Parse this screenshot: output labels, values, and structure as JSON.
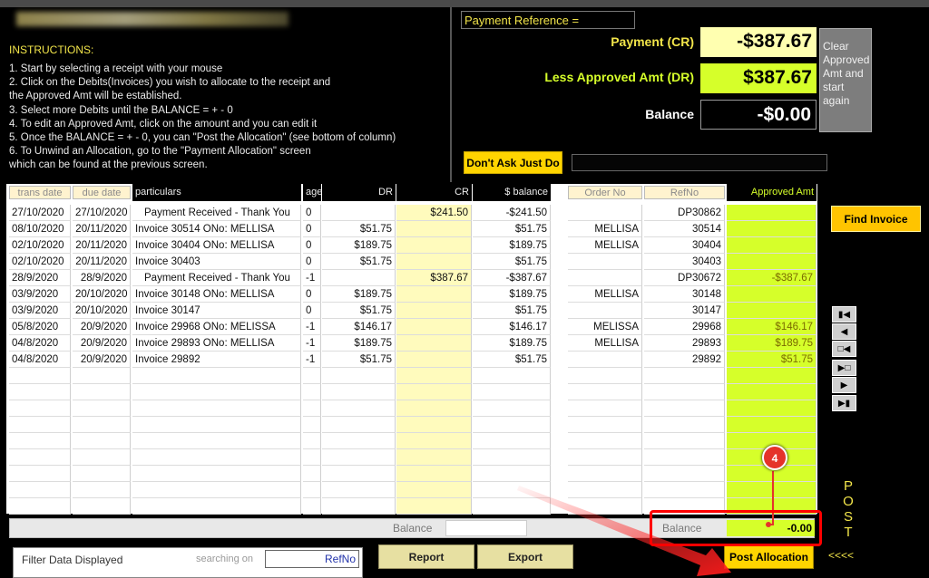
{
  "instructions": {
    "title": "INSTRUCTIONS:",
    "lines": [
      "1. Start by selecting a receipt with your mouse",
      "2. Click on the Debits(Invoices) you wish to allocate to the receipt and",
      "    the Approved Amt will be established.",
      "3. Select more Debits until the BALANCE = + - 0",
      "4. To edit an Approved Amt, click on the amount and you can edit it",
      "5. Once the BALANCE = + - 0, you can \"Post the Allocation\" (see bottom of column)",
      "6. To Unwind an Allocation, go to the \"Payment Allocation\" screen",
      "    which can be found at the previous screen."
    ]
  },
  "summary": {
    "payment_reference_label": "Payment Reference =",
    "payment_label": "Payment (CR)",
    "payment_value": "-$387.67",
    "less_label": "Less Approved Amt (DR)",
    "less_value": "$387.67",
    "balance_label": "Balance",
    "balance_value": "-$0.00",
    "clear_button": "Clear Approved Amt and start again",
    "dont_ask_button": "Don't Ask Just Do"
  },
  "grid": {
    "headers": {
      "trans_date": "trans date",
      "due_date": "due date",
      "particulars": "particulars",
      "age": "age",
      "dr": "DR",
      "cr": "CR",
      "balance": "$ balance",
      "order_no": "Order No",
      "ref_no": "RefNo",
      "approved": "Approved Amt"
    },
    "rows": [
      {
        "trans": "27/10/2020",
        "due": "27/10/2020",
        "part": "Payment Received - Thank You",
        "age": "0",
        "dr": "",
        "cr": "$241.50",
        "bal": "-$241.50",
        "order": "",
        "ref": "DP30862",
        "appr": ""
      },
      {
        "trans": "08/10/2020",
        "due": "20/11/2020",
        "part": "Invoice 30514 ONo: MELLISA",
        "age": "0",
        "dr": "$51.75",
        "cr": "",
        "bal": "$51.75",
        "order": "MELLISA",
        "ref": "30514",
        "appr": ""
      },
      {
        "trans": "02/10/2020",
        "due": "20/11/2020",
        "part": "Invoice 30404 ONo: MELLISA",
        "age": "0",
        "dr": "$189.75",
        "cr": "",
        "bal": "$189.75",
        "order": "MELLISA",
        "ref": "30404",
        "appr": ""
      },
      {
        "trans": "02/10/2020",
        "due": "20/11/2020",
        "part": "Invoice 30403",
        "age": "0",
        "dr": "$51.75",
        "cr": "",
        "bal": "$51.75",
        "order": "",
        "ref": "30403",
        "appr": ""
      },
      {
        "trans": "28/9/2020",
        "due": "28/9/2020",
        "part": "Payment Received - Thank You",
        "age": "-1",
        "dr": "",
        "cr": "$387.67",
        "bal": "-$387.67",
        "order": "",
        "ref": "DP30672",
        "appr": "-$387.67"
      },
      {
        "trans": "03/9/2020",
        "due": "20/10/2020",
        "part": "Invoice 30148 ONo: MELLISA",
        "age": "0",
        "dr": "$189.75",
        "cr": "",
        "bal": "$189.75",
        "order": "MELLISA",
        "ref": "30148",
        "appr": ""
      },
      {
        "trans": "03/9/2020",
        "due": "20/10/2020",
        "part": "Invoice 30147",
        "age": "0",
        "dr": "$51.75",
        "cr": "",
        "bal": "$51.75",
        "order": "",
        "ref": "30147",
        "appr": ""
      },
      {
        "trans": "05/8/2020",
        "due": "20/9/2020",
        "part": "Invoice 29968 ONo: MELISSA",
        "age": "-1",
        "dr": "$146.17",
        "cr": "",
        "bal": "$146.17",
        "order": "MELISSA",
        "ref": "29968",
        "appr": "$146.17"
      },
      {
        "trans": "04/8/2020",
        "due": "20/9/2020",
        "part": "Invoice 29893 ONo: MELLISA",
        "age": "-1",
        "dr": "$189.75",
        "cr": "",
        "bal": "$189.75",
        "order": "MELLISA",
        "ref": "29893",
        "appr": "$189.75"
      },
      {
        "trans": "04/8/2020",
        "due": "20/9/2020",
        "part": "Invoice 29892",
        "age": "-1",
        "dr": "$51.75",
        "cr": "",
        "bal": "$51.75",
        "order": "",
        "ref": "29892",
        "appr": "$51.75"
      }
    ],
    "footer_balance_label": "Balance",
    "footer_balance_label2": "Balance",
    "footer_balance_value": "-0.00"
  },
  "bottom": {
    "filter_label": "Filter Data Displayed",
    "search_label": "searching on",
    "search_value": "RefNo",
    "report_button": "Report",
    "export_button": "Export",
    "post_button": "Post Allocation"
  },
  "sidebar": {
    "find_button": "Find Invoice",
    "nav_buttons": [
      "first-record-icon",
      "previous-record-icon",
      "new-before-icon",
      "new-after-icon",
      "next-record-icon",
      "last-record-icon"
    ],
    "post_letters": [
      "P",
      "O",
      "S",
      "T"
    ],
    "arrows": "<<<<"
  },
  "annotation": {
    "badge": "4",
    "color": "#ff0000"
  }
}
